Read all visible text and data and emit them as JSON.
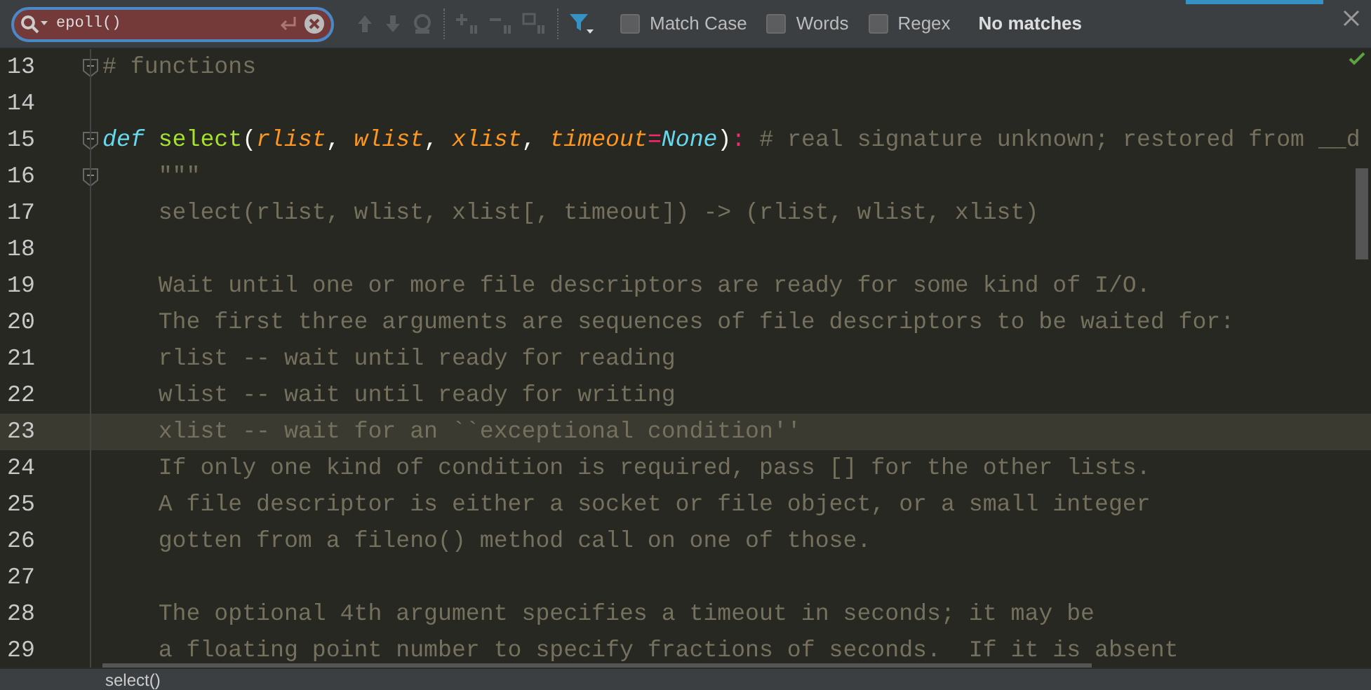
{
  "search": {
    "value": "epoll()",
    "error": true
  },
  "options": [
    {
      "label": "Match Case",
      "checked": false
    },
    {
      "label": "Words",
      "checked": false
    },
    {
      "label": "Regex",
      "checked": false
    }
  ],
  "result": "No matches",
  "lines": [
    {
      "number": "13",
      "fold": true,
      "current": false,
      "tokens": [
        {
          "kind": "comment",
          "text": "# functions"
        }
      ]
    },
    {
      "number": "14",
      "fold": false,
      "current": false
    },
    {
      "number": "15",
      "fold": true,
      "current": false,
      "tokens": [
        {
          "kind": "keyword",
          "text": "def "
        },
        {
          "kind": "function",
          "text": "select"
        },
        {
          "kind": "plain",
          "text": "("
        },
        {
          "kind": "param",
          "text": "rlist"
        },
        {
          "kind": "plain",
          "text": ", "
        },
        {
          "kind": "param",
          "text": "wlist"
        },
        {
          "kind": "plain",
          "text": ", "
        },
        {
          "kind": "param",
          "text": "xlist"
        },
        {
          "kind": "plain",
          "text": ", "
        },
        {
          "kind": "param",
          "text": "timeout"
        },
        {
          "kind": "operator",
          "text": "="
        },
        {
          "kind": "keyword",
          "text": "None"
        },
        {
          "kind": "plain",
          "text": ")"
        },
        {
          "kind": "operator",
          "text": ":"
        },
        {
          "kind": "comment",
          "text": " # real signature unknown; restored from __d"
        }
      ]
    },
    {
      "number": "16",
      "fold": true,
      "current": false,
      "tokens": [
        {
          "kind": "doc",
          "text": "    \"\"\""
        }
      ]
    },
    {
      "number": "17",
      "fold": false,
      "current": false,
      "tokens": [
        {
          "kind": "doc",
          "text": "    select(rlist, wlist, xlist[, timeout]) -> (rlist, wlist, xlist)"
        }
      ]
    },
    {
      "number": "18",
      "fold": false,
      "current": false
    },
    {
      "number": "19",
      "fold": false,
      "current": false,
      "tokens": [
        {
          "kind": "doc",
          "text": "    Wait until one or more file descriptors are ready for some kind of I/O."
        }
      ]
    },
    {
      "number": "20",
      "fold": false,
      "current": false,
      "tokens": [
        {
          "kind": "doc",
          "text": "    The first three arguments are sequences of file descriptors to be waited for:"
        }
      ]
    },
    {
      "number": "21",
      "fold": false,
      "current": false,
      "tokens": [
        {
          "kind": "doc",
          "text": "    rlist -- wait until ready for reading"
        }
      ]
    },
    {
      "number": "22",
      "fold": false,
      "current": false,
      "tokens": [
        {
          "kind": "doc",
          "text": "    wlist -- wait until ready for writing"
        }
      ]
    },
    {
      "number": "23",
      "fold": false,
      "current": true,
      "tokens": [
        {
          "kind": "doc",
          "text": "    xlist -- wait for an ``exceptional condition''"
        }
      ]
    },
    {
      "number": "24",
      "fold": false,
      "current": false,
      "tokens": [
        {
          "kind": "doc",
          "text": "    If only one kind of condition is required, pass [] for the other lists."
        }
      ]
    },
    {
      "number": "25",
      "fold": false,
      "current": false,
      "tokens": [
        {
          "kind": "doc",
          "text": "    A file descriptor is either a socket or file object, or a small integer"
        }
      ]
    },
    {
      "number": "26",
      "fold": false,
      "current": false,
      "tokens": [
        {
          "kind": "doc",
          "text": "    gotten from a fileno() method call on one of those."
        }
      ]
    },
    {
      "number": "27",
      "fold": false,
      "current": false
    },
    {
      "number": "28",
      "fold": false,
      "current": false,
      "tokens": [
        {
          "kind": "doc",
          "text": "    The optional 4th argument specifies a timeout in seconds; it may be"
        }
      ]
    },
    {
      "number": "29",
      "fold": false,
      "current": false,
      "tokens": [
        {
          "kind": "doc",
          "text": "    a floating point number to specify fractions of seconds.  If it is absent"
        }
      ]
    }
  ],
  "status_bar": {
    "text": "select()"
  }
}
